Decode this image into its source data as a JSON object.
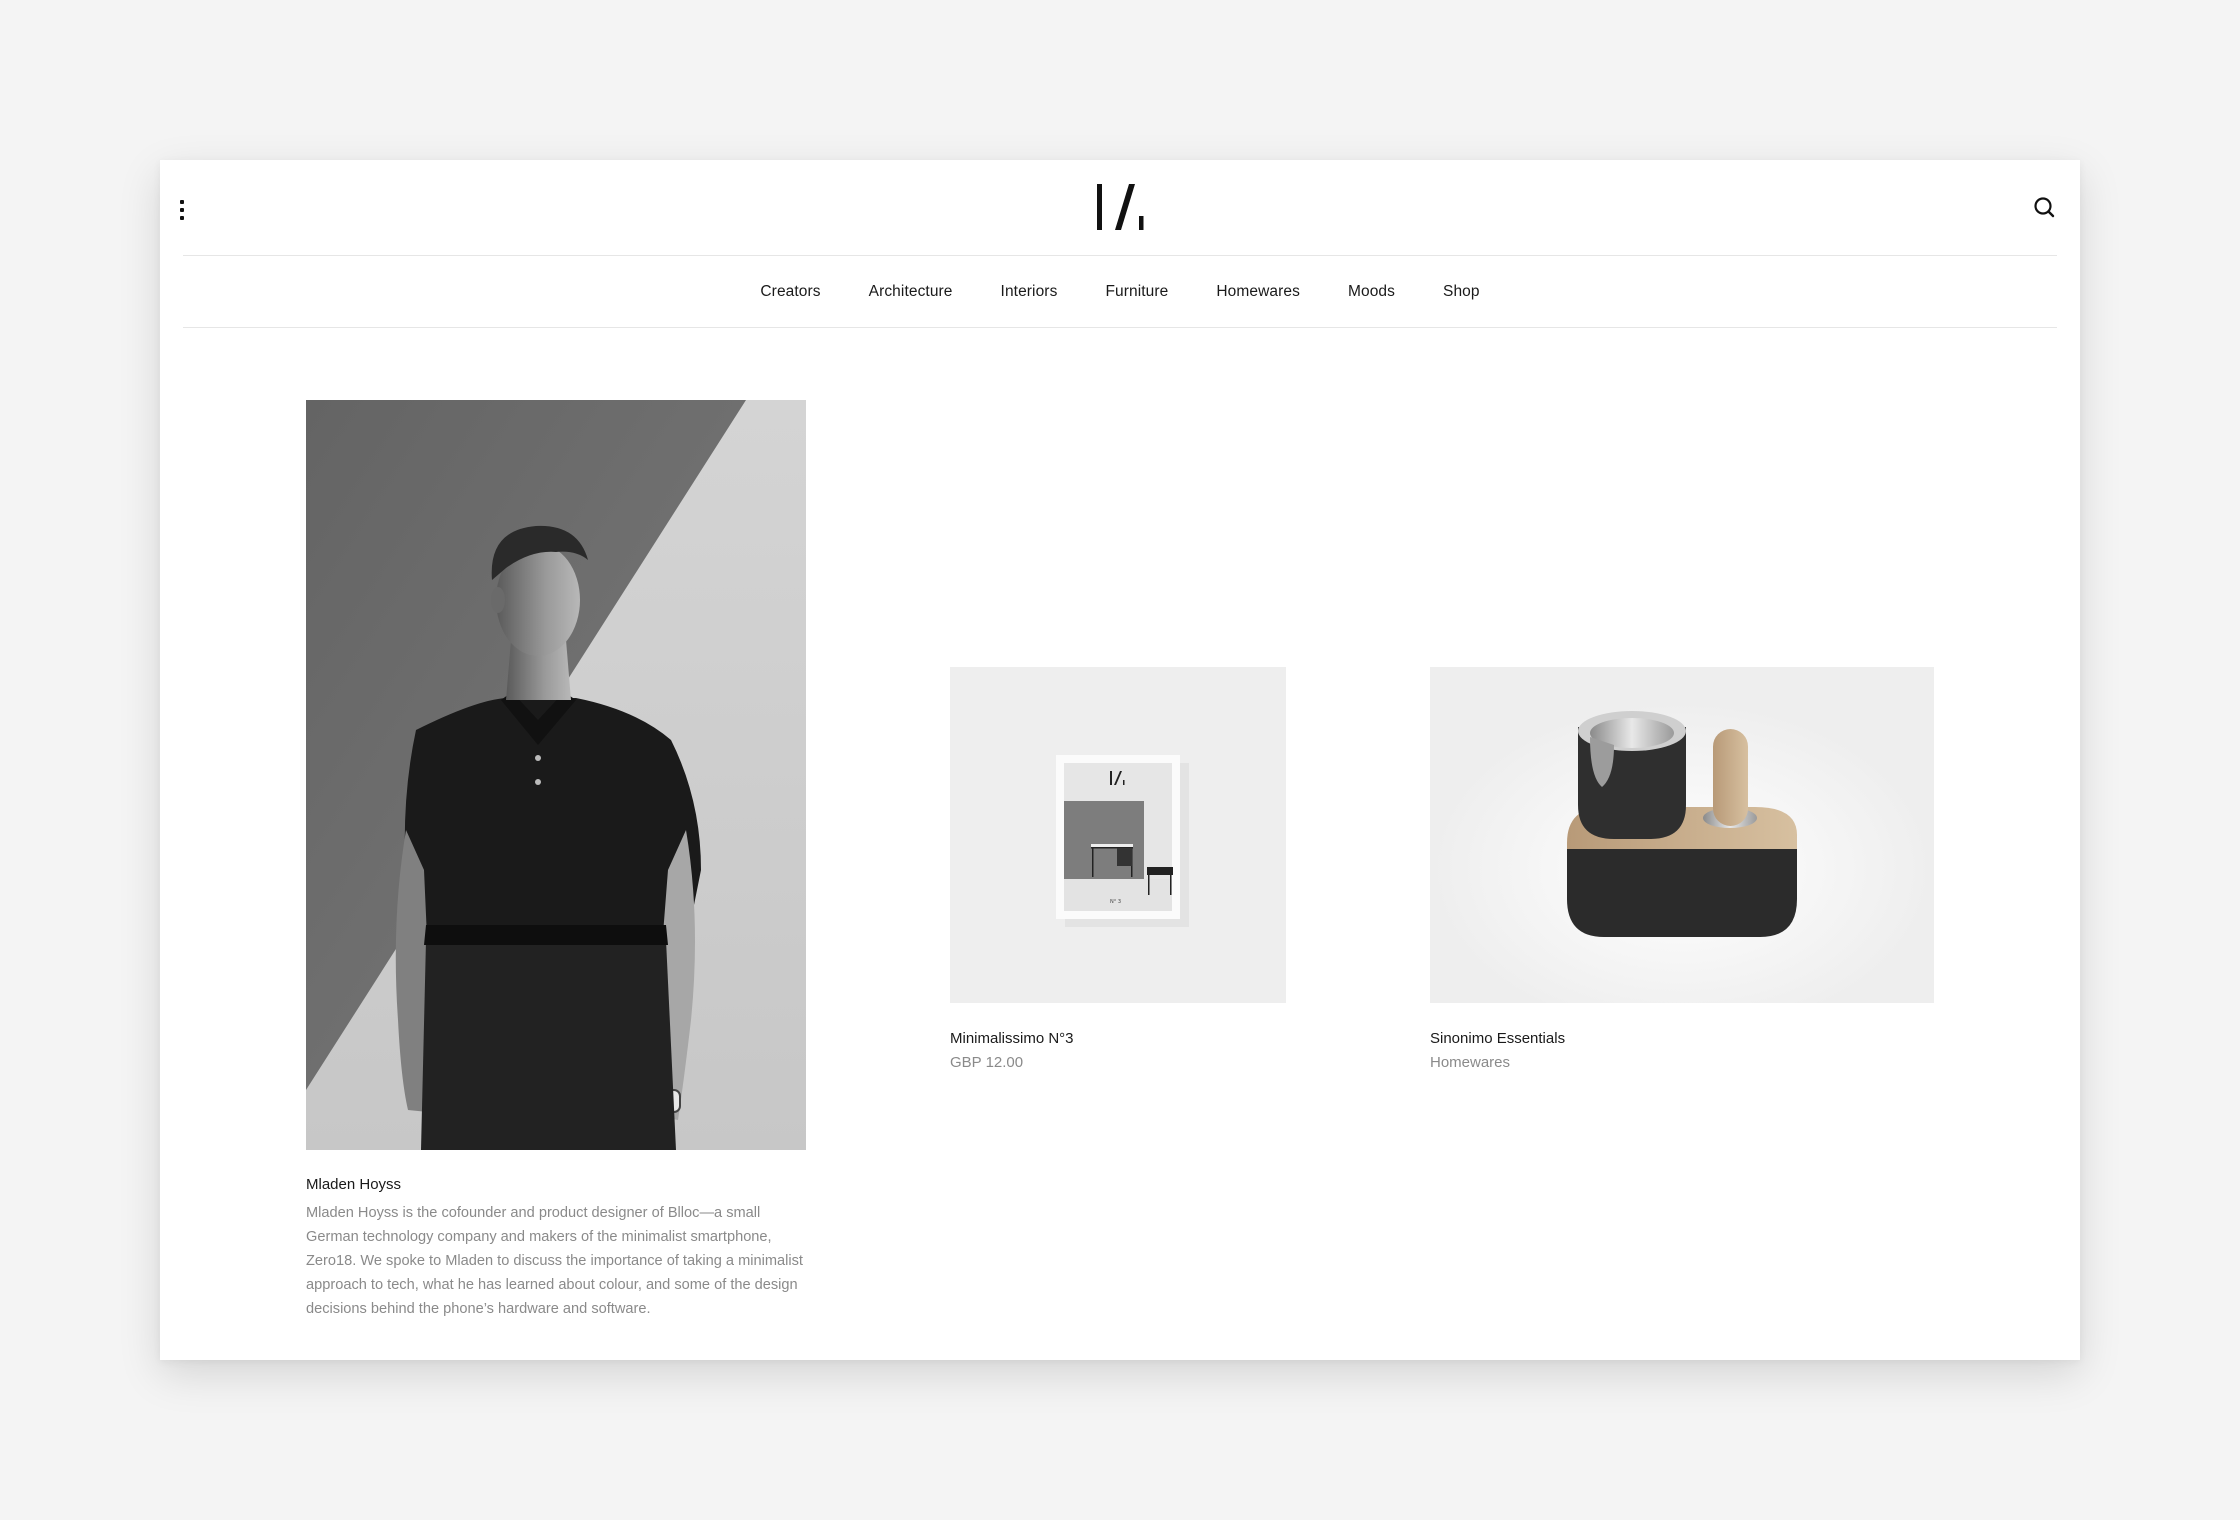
{
  "header": {
    "logo_alt": "IZ logo mark",
    "menu_icon": "vertical-dots-menu-icon",
    "search_icon": "search-icon"
  },
  "nav": {
    "items": [
      {
        "label": "Creators"
      },
      {
        "label": "Architecture"
      },
      {
        "label": "Interiors"
      },
      {
        "label": "Furniture"
      },
      {
        "label": "Homewares"
      },
      {
        "label": "Moods"
      },
      {
        "label": "Shop"
      }
    ]
  },
  "feature": {
    "title": "Mladen Hoyss",
    "description": "Mladen Hoyss is the cofounder and product designer of Blloc—a small German technology company and makers of the minimalist smartphone, Zero18. We spoke to Mladen to discuss the importance of taking a minimalist approach to tech, what he has learned about colour, and some of the design decisions behind the phone’s hardware and software.",
    "image_alt": "Black and white portrait of a man in a dark polo shirt against a wall"
  },
  "products": [
    {
      "title": "Minimalissimo N°3",
      "subtitle": "GBP 12.00",
      "image_alt": "Magazine cover Minimalissimo issue 3",
      "cover_issue": "N° 3"
    },
    {
      "title": "Sinonimo Essentials",
      "subtitle": "Homewares",
      "image_alt": "Black and oak mortar and pestle set"
    }
  ],
  "colors": {
    "background": "#f4f4f4",
    "window": "#ffffff",
    "text_primary": "#1a1a1a",
    "text_secondary": "#8a8a8a",
    "rule": "#e6e6e6"
  }
}
